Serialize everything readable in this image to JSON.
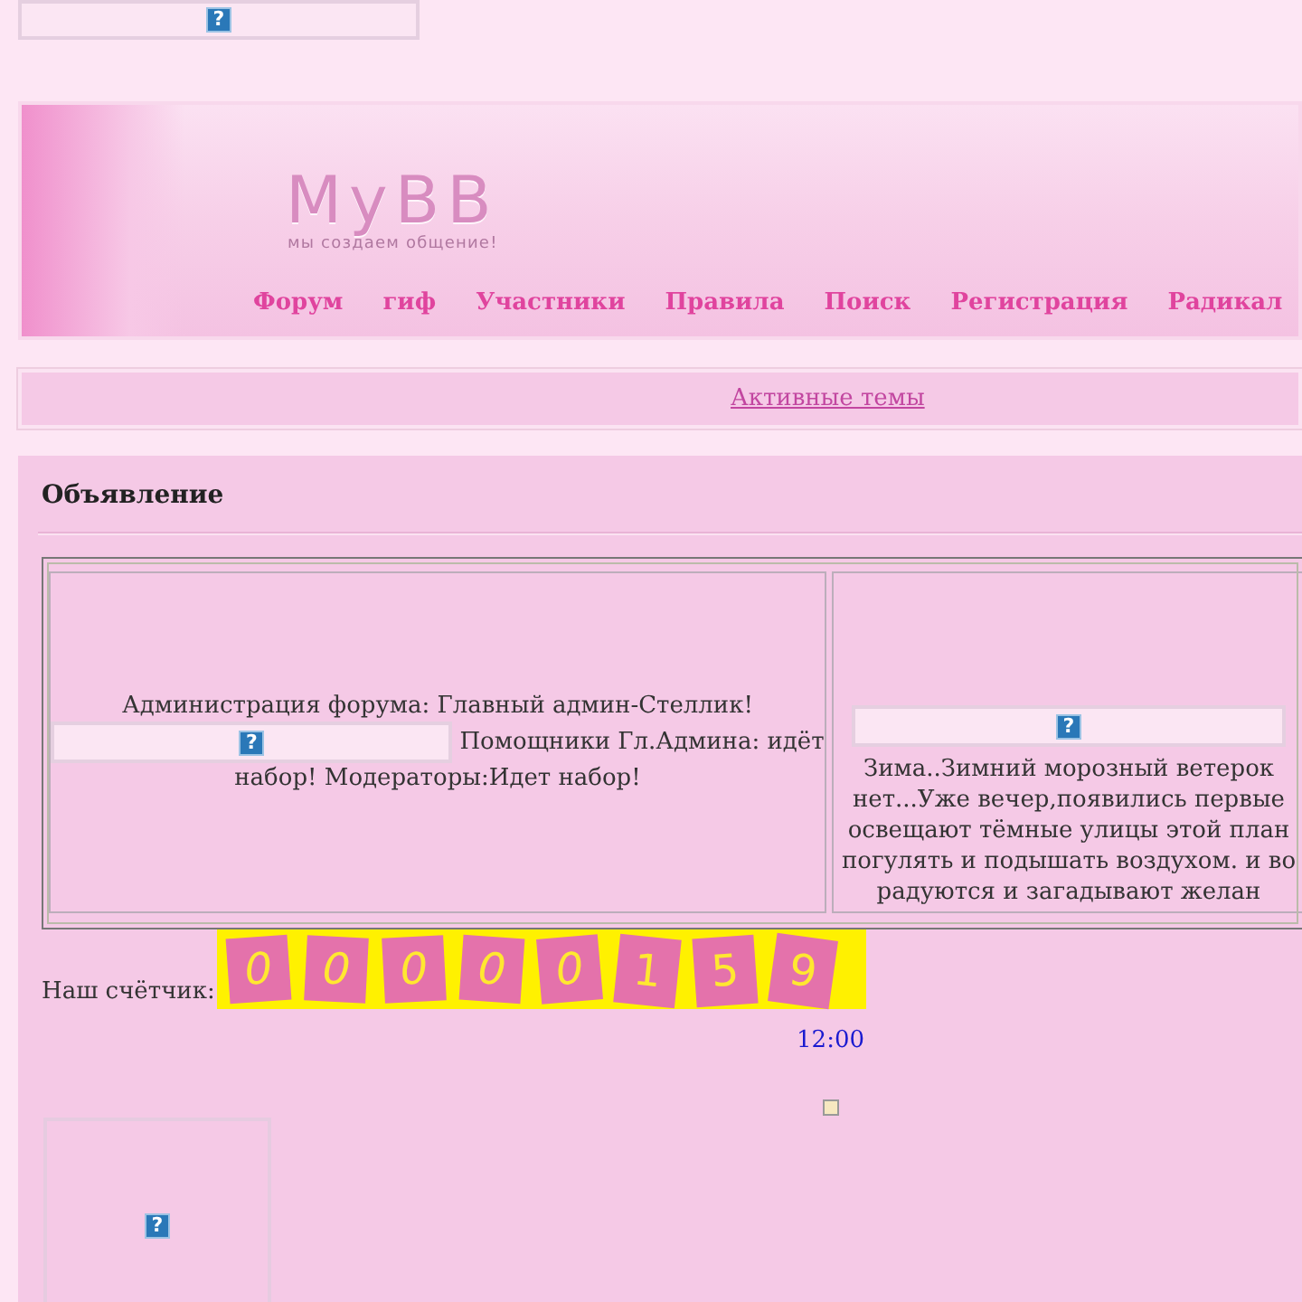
{
  "top_banner": {
    "image": {
      "mark": "?"
    }
  },
  "header": {
    "logo": "MyBB",
    "tagline": "мы создаем общение!",
    "nav": [
      {
        "label": "Форум"
      },
      {
        "label": "гиф"
      },
      {
        "label": "Участники"
      },
      {
        "label": "Правила"
      },
      {
        "label": "Поиск"
      },
      {
        "label": "Регистрация"
      },
      {
        "label": "Радикал"
      }
    ]
  },
  "active_topics_link": "Активные темы",
  "announcement": {
    "title": "Объявление",
    "left_cell": {
      "text_1": "Администрация форума: Главный админ-Стеллик!",
      "image": {
        "mark": "?"
      },
      "text_2": "Помощники Гл.Админа: идёт",
      "text_3": "набор! Модераторы:Идет набор!"
    },
    "right_cell": {
      "image": {
        "mark": "?"
      },
      "lines": [
        "Зима..Зимний морозный ветерок",
        "нет...Уже вечер,появились первые",
        "освещают тёмные улицы этой план",
        "погулять и подышать воздухом. и во",
        "радуются и загадывают желан"
      ]
    },
    "counter": {
      "label": "Наш счётчик:",
      "digits": [
        "0",
        "0",
        "0",
        "0",
        "0",
        "1",
        "5",
        "9"
      ]
    },
    "time": "12:00",
    "bottom_image": {
      "mark": "?"
    }
  }
}
